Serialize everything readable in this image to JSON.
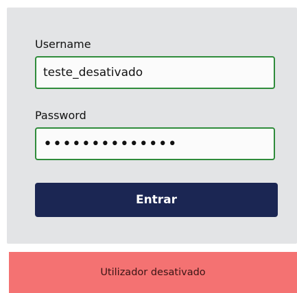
{
  "login_form": {
    "username_label": "Username",
    "username_value": "teste_desativado",
    "password_label": "Password",
    "password_value": "••••••••••••••",
    "submit_label": "Entrar"
  },
  "alert": {
    "message": "Utilizador desativado"
  },
  "colors": {
    "card_background": "#e3e4e6",
    "input_border": "#2e8b3a",
    "button_background": "#1b2653",
    "alert_background": "#f47272"
  }
}
